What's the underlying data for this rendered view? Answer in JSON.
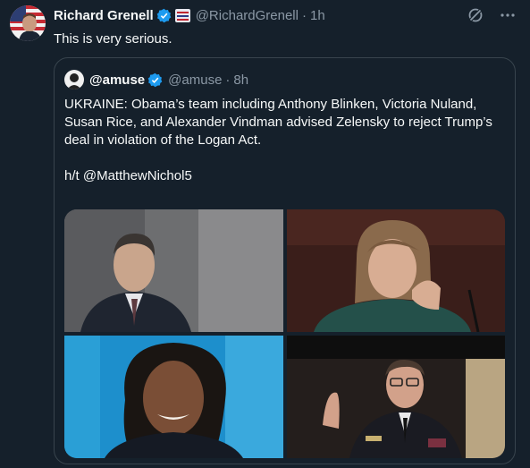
{
  "tweet": {
    "author_name": "Richard Grenell",
    "author_handle": "@RichardGrenell",
    "separator": "·",
    "time": "1h",
    "text": "This is very serious.",
    "avatar_icon": "profile-photo-flag",
    "action_icons": [
      "grok-icon",
      "more-icon"
    ]
  },
  "quote": {
    "author_name": "@amuse",
    "author_handle": "@amuse",
    "separator": "·",
    "time": "8h",
    "text_line1": "UKRAINE: Obama’s team including Anthony Blinken, Victoria Nuland, Susan Rice, and Alexander Vindman advised Zelensky to reject Trump’s deal in violation of the Logan Act.",
    "text_line2": "h/t @MatthewNichol5",
    "photos": [
      {
        "subject": "man in dark suit, grey background"
      },
      {
        "subject": "woman with hand on chin, dark red background"
      },
      {
        "subject": "woman smiling, blue background"
      },
      {
        "subject": "uniformed officer raising right hand"
      }
    ]
  },
  "colors": {
    "background": "#15202b",
    "border": "#38444d",
    "text": "#f7f9f9",
    "muted": "#8b98a5",
    "verified": "#1d9bf0"
  }
}
